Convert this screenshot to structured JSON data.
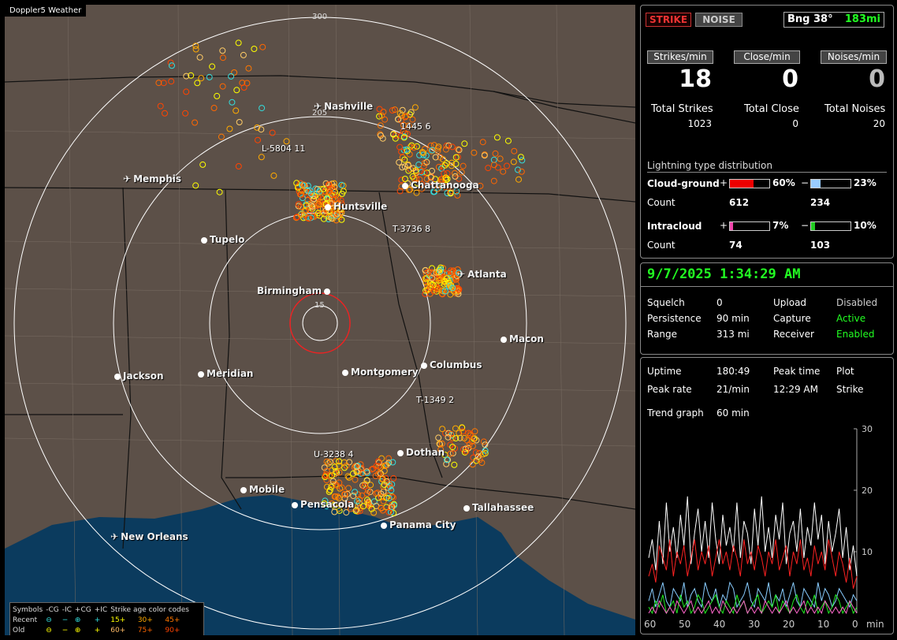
{
  "map": {
    "title": "Doppler5 Weather",
    "ring_labels": [
      "300",
      "205",
      "15"
    ],
    "cities": [
      {
        "name": "Nashville",
        "kind": "airport"
      },
      {
        "name": "Memphis",
        "kind": "airport"
      },
      {
        "name": "Chattanooga",
        "kind": "city"
      },
      {
        "name": "Huntsville",
        "kind": "city"
      },
      {
        "name": "Tupelo",
        "kind": "city"
      },
      {
        "name": "Atlanta",
        "kind": "airport"
      },
      {
        "name": "Birmingham",
        "kind": "city"
      },
      {
        "name": "Macon",
        "kind": "city"
      },
      {
        "name": "Jackson",
        "kind": "city"
      },
      {
        "name": "Meridian",
        "kind": "city"
      },
      {
        "name": "Montgomery",
        "kind": "city"
      },
      {
        "name": "Columbus",
        "kind": "city"
      },
      {
        "name": "Dothan",
        "kind": "city"
      },
      {
        "name": "Mobile",
        "kind": "city"
      },
      {
        "name": "Pensacola",
        "kind": "city"
      },
      {
        "name": "Tallahassee",
        "kind": "city"
      },
      {
        "name": "Panama City",
        "kind": "city"
      },
      {
        "name": "New Orleans",
        "kind": "airport"
      }
    ],
    "storm_labels": [
      "L-5804 11",
      "1445 6",
      "T-3736 8",
      "T-1349 2",
      "U-3238 4"
    ]
  },
  "legend": {
    "symbols_label": "Symbols",
    "cols": [
      "-CG",
      "-IC",
      "+CG",
      "+IC"
    ],
    "age_title": "Strike age color codes",
    "recent_label": "Recent",
    "old_label": "Old",
    "recent_ages": [
      "15+",
      "30+",
      "45+"
    ],
    "old_ages": [
      "60+",
      "75+",
      "90+"
    ],
    "age_colors": [
      "#ffff00",
      "#ffaa00",
      "#ff7700",
      "#ffcc66",
      "#ff6600",
      "#ff4400"
    ]
  },
  "panel": {
    "strike_btn": "STRIKE",
    "noise_btn": "NOISE",
    "bearing": "Bng 38°",
    "distance": "183mi",
    "strikes_min_label": "Strikes/min",
    "close_min_label": "Close/min",
    "noises_min_label": "Noises/min",
    "strikes_min": "18",
    "close_min": "0",
    "noises_min": "0",
    "total_strikes_label": "Total Strikes",
    "total_close_label": "Total Close",
    "total_noises_label": "Total Noises",
    "total_strikes": "1023",
    "total_close": "0",
    "total_noises": "20",
    "dist_title": "Lightning type distribution",
    "cg_label": "Cloud-ground",
    "ic_label": "Intracloud",
    "count_label": "Count",
    "plus": "+",
    "minus": "−",
    "cg_pos_pct": "60%",
    "cg_neg_pct": "23%",
    "cg_pos_count": "612",
    "cg_neg_count": "234",
    "ic_pos_pct": "7%",
    "ic_neg_pct": "10%",
    "ic_pos_count": "74",
    "ic_neg_count": "103",
    "cg_pos_frac": 0.6,
    "cg_neg_frac": 0.23,
    "ic_pos_frac": 0.07,
    "ic_neg_frac": 0.1
  },
  "status": {
    "datetime": "9/7/2025 1:34:29 AM",
    "squelch_label": "Squelch",
    "squelch": "0",
    "persistence_label": "Persistence",
    "persistence": "90 min",
    "range_label": "Range",
    "range": "313 mi",
    "upload_label": "Upload",
    "upload": "Disabled",
    "capture_label": "Capture",
    "capture": "Active",
    "receiver_label": "Receiver",
    "receiver": "Enabled"
  },
  "stats": {
    "uptime_label": "Uptime",
    "uptime": "180:49",
    "peak_time_label": "Peak time",
    "peak_time": "12:29 AM",
    "plot_label": "Plot",
    "plot": "Strike",
    "peak_rate_label": "Peak rate",
    "peak_rate": "21/min",
    "trend_label": "Trend graph",
    "trend": "60 min"
  },
  "chart_data": {
    "type": "line",
    "x_ticks": [
      "60",
      "50",
      "40",
      "30",
      "20",
      "10",
      "0"
    ],
    "xlabel": "min",
    "y_ticks": [
      "30",
      "20",
      "10"
    ],
    "ylim": [
      0,
      30
    ],
    "series": [
      {
        "color": "#ffffff",
        "values": [
          9,
          12,
          7,
          15,
          8,
          18,
          10,
          14,
          9,
          16,
          11,
          19,
          8,
          13,
          17,
          10,
          15,
          9,
          18,
          12,
          8,
          16,
          11,
          14,
          10,
          18,
          9,
          15,
          13,
          8,
          17,
          11,
          19,
          10,
          14,
          9,
          16,
          12,
          18,
          8,
          13,
          15,
          10,
          17,
          9,
          14,
          11,
          18,
          12,
          16,
          8,
          15,
          10,
          13,
          17,
          9,
          14,
          7,
          11,
          6
        ]
      },
      {
        "color": "#ff2222",
        "values": [
          6,
          8,
          5,
          11,
          9,
          7,
          12,
          6,
          10,
          8,
          11,
          6,
          9,
          12,
          7,
          10,
          8,
          11,
          6,
          9,
          12,
          8,
          10,
          7,
          11,
          9,
          6,
          12,
          8,
          10,
          7,
          11,
          9,
          6,
          10,
          8,
          12,
          7,
          9,
          11,
          6,
          10,
          8,
          12,
          7,
          9,
          6,
          11,
          8,
          10,
          7,
          12,
          9,
          6,
          10,
          8,
          5,
          9,
          4,
          6
        ]
      },
      {
        "color": "#88ccff",
        "values": [
          2,
          4,
          1,
          3,
          5,
          2,
          1,
          4,
          3,
          2,
          5,
          1,
          3,
          4,
          2,
          1,
          5,
          3,
          2,
          4,
          1,
          3,
          2,
          5,
          4,
          1,
          2,
          3,
          5,
          2,
          1,
          4,
          3,
          2,
          5,
          1,
          3,
          2,
          4,
          1,
          3,
          5,
          2,
          1,
          4,
          3,
          2,
          1,
          5,
          2,
          4,
          3,
          1,
          2,
          4,
          3,
          2,
          1,
          3,
          2
        ]
      },
      {
        "color": "#22ee22",
        "values": [
          1,
          0,
          2,
          1,
          3,
          0,
          1,
          2,
          0,
          3,
          1,
          2,
          0,
          1,
          3,
          2,
          0,
          1,
          2,
          3,
          1,
          0,
          2,
          1,
          0,
          3,
          1,
          2,
          0,
          1,
          2,
          3,
          0,
          1,
          2,
          1,
          3,
          0,
          2,
          1,
          0,
          2,
          3,
          1,
          0,
          2,
          1,
          3,
          0,
          1,
          2,
          0,
          1,
          3,
          2,
          0,
          1,
          2,
          0,
          1
        ]
      },
      {
        "color": "#ff66cc",
        "values": [
          0,
          1,
          0,
          2,
          1,
          0,
          1,
          0,
          2,
          1,
          0,
          1,
          2,
          0,
          1,
          0,
          1,
          2,
          0,
          1,
          0,
          2,
          1,
          0,
          1,
          0,
          1,
          2,
          0,
          1,
          0,
          1,
          0,
          2,
          1,
          0,
          1,
          0,
          1,
          2,
          0,
          1,
          0,
          1,
          2,
          0,
          1,
          0,
          1,
          0,
          2,
          1,
          0,
          1,
          0,
          1,
          0,
          2,
          1,
          0
        ]
      }
    ]
  }
}
